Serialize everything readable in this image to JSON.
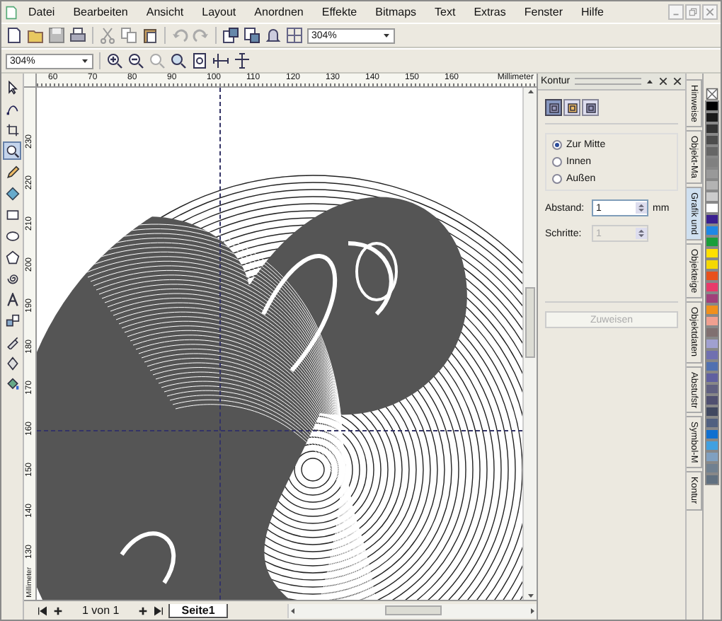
{
  "menu": [
    "Datei",
    "Bearbeiten",
    "Ansicht",
    "Layout",
    "Anordnen",
    "Effekte",
    "Bitmaps",
    "Text",
    "Extras",
    "Fenster",
    "Hilfe"
  ],
  "standard_toolbar": {
    "zoom_level": "304%"
  },
  "zoom_toolbar": {
    "zoom_level": "304%"
  },
  "toolbox": [
    {
      "selected": false
    },
    {
      "selected": false
    },
    {
      "selected": false
    },
    {
      "selected": true
    },
    {
      "selected": false
    },
    {
      "selected": false
    },
    {
      "selected": false
    },
    {
      "selected": false
    },
    {
      "selected": false
    },
    {
      "selected": false
    },
    {
      "selected": false
    },
    {
      "selected": false
    },
    {
      "selected": false
    },
    {
      "selected": false
    },
    {
      "selected": false
    }
  ],
  "ruler_top": {
    "labels": [
      "60",
      "70",
      "80",
      "90",
      "100",
      "110",
      "120",
      "130",
      "140",
      "150",
      "160"
    ],
    "unit": "Millimeter"
  },
  "ruler_left": {
    "labels": [
      "230",
      "220",
      "210",
      "200",
      "190",
      "180",
      "170",
      "160",
      "150",
      "140",
      "130"
    ],
    "unit": "Millimeter"
  },
  "page_nav": {
    "position": "1 von 1",
    "tabs": [
      {
        "label": "Seite1",
        "selected": true
      }
    ]
  },
  "docker": {
    "title": "Kontur",
    "modes": [
      {
        "selected": true
      },
      {
        "selected": false
      },
      {
        "selected": false
      }
    ],
    "options": [
      {
        "label": "Zur Mitte",
        "selected": true
      },
      {
        "label": "Innen",
        "selected": false
      },
      {
        "label": "Außen",
        "selected": false
      }
    ],
    "fields": [
      {
        "label": "Abstand:",
        "value": "1",
        "unit": "mm",
        "disabled": false
      },
      {
        "label": "Schritte:",
        "value": "1",
        "disabled": true
      }
    ],
    "apply_button": {
      "label": "Zuweisen",
      "disabled": true
    }
  },
  "docker_tabs": [
    {
      "label": "Hinweise",
      "selected": false
    },
    {
      "label": "Objekt-Ma",
      "selected": false
    },
    {
      "label": "Grafik und",
      "selected": true
    },
    {
      "label": "Objekteige",
      "selected": false
    },
    {
      "label": "Objektdaten",
      "selected": false
    },
    {
      "label": "Abstufstr",
      "selected": false
    },
    {
      "label": "Symbol-M",
      "selected": false
    },
    {
      "label": "Kontur",
      "selected": false
    }
  ],
  "palette": [
    {
      "color": "#000000"
    },
    {
      "color": "#1a1a1a"
    },
    {
      "color": "#333333"
    },
    {
      "color": "#4d4d4d"
    },
    {
      "color": "#666666"
    },
    {
      "color": "#808080"
    },
    {
      "color": "#999999"
    },
    {
      "color": "#b3b3b3"
    },
    {
      "color": "#cccccc"
    },
    {
      "color": "#ffffff"
    },
    {
      "color": "#3a1f8f"
    },
    {
      "color": "#1e88e5"
    },
    {
      "color": "#1a9e3a"
    },
    {
      "color": "#ffe000"
    },
    {
      "color": "#f5d800"
    },
    {
      "color": "#e8501c"
    },
    {
      "color": "#e83a6a"
    },
    {
      "color": "#a0407a"
    },
    {
      "color": "#f0901c"
    },
    {
      "color": "#f0a090"
    },
    {
      "color": "#807070"
    },
    {
      "color": "#a0a0d0"
    },
    {
      "color": "#7070b0"
    },
    {
      "color": "#5070b0"
    },
    {
      "color": "#6060a0"
    },
    {
      "color": "#606080"
    },
    {
      "color": "#505070"
    },
    {
      "color": "#404860"
    },
    {
      "color": "#506080"
    },
    {
      "color": "#1070d0"
    },
    {
      "color": "#40a0e0"
    },
    {
      "color": "#80a0c0"
    },
    {
      "color": "#708090"
    },
    {
      "color": "#607080"
    }
  ]
}
